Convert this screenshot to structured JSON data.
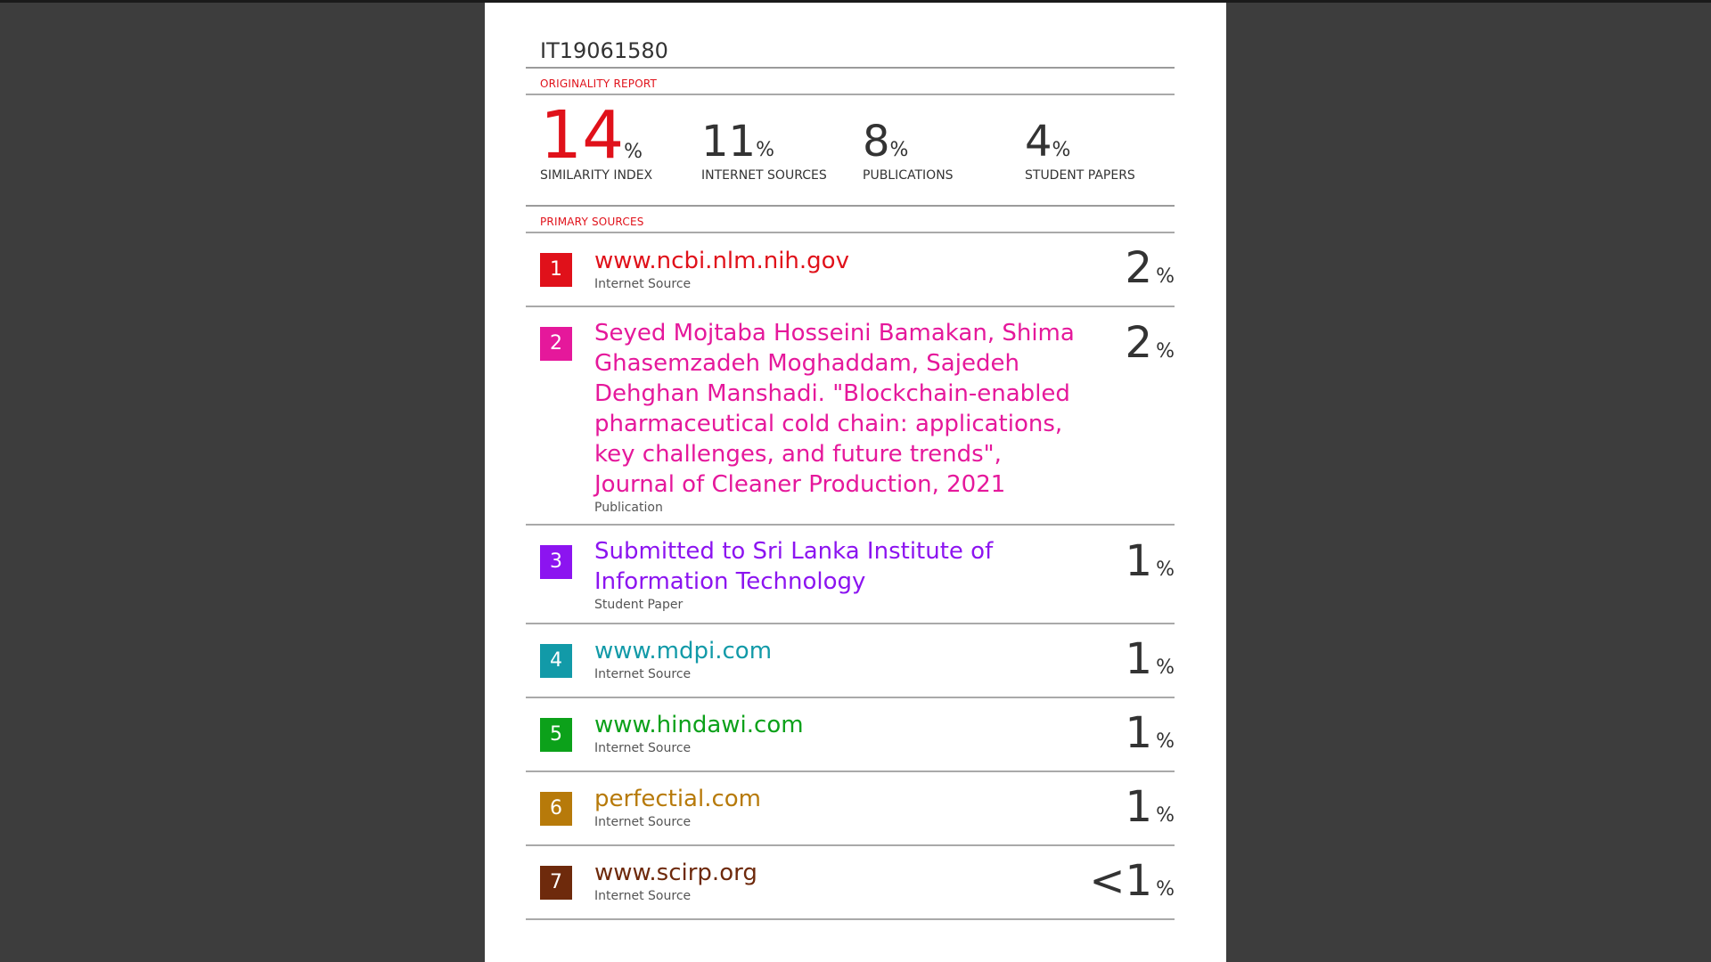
{
  "document_id": "IT19061580",
  "originality_report_label": "ORIGINALITY REPORT",
  "stats": [
    {
      "value": "14",
      "unit": "%",
      "label": "SIMILARITY INDEX"
    },
    {
      "value": "11",
      "unit": "%",
      "label": "INTERNET SOURCES"
    },
    {
      "value": "8",
      "unit": "%",
      "label": "PUBLICATIONS"
    },
    {
      "value": "4",
      "unit": "%",
      "label": "STUDENT PAPERS"
    }
  ],
  "primary_sources_label": "PRIMARY SOURCES",
  "sources": [
    {
      "rank": "1",
      "title": "www.ncbi.nlm.nih.gov",
      "type": "Internet Source",
      "percent": "2",
      "unit": "%",
      "color": "#e0111a"
    },
    {
      "rank": "2",
      "title": "Seyed Mojtaba Hosseini Bamakan, Shima Ghasemzadeh Moghaddam, Sajedeh Dehghan Manshadi. \"Blockchain-enabled pharmaceutical cold chain: applications, key challenges, and future trends\", Journal of Cleaner Production, 2021",
      "type": "Publication",
      "percent": "2",
      "unit": "%",
      "color": "#e5189b"
    },
    {
      "rank": "3",
      "title": "Submitted to Sri Lanka Institute of Information Technology",
      "type": "Student Paper",
      "percent": "1",
      "unit": "%",
      "color": "#8c14f0"
    },
    {
      "rank": "4",
      "title": "www.mdpi.com",
      "type": "Internet Source",
      "percent": "1",
      "unit": "%",
      "color": "#129aa8"
    },
    {
      "rank": "5",
      "title": "www.hindawi.com",
      "type": "Internet Source",
      "percent": "1",
      "unit": "%",
      "color": "#0ca11a"
    },
    {
      "rank": "6",
      "title": "perfectial.com",
      "type": "Internet Source",
      "percent": "1",
      "unit": "%",
      "color": "#b77a0a"
    },
    {
      "rank": "7",
      "title": "www.scirp.org",
      "type": "Internet Source",
      "percent": "<1",
      "unit": "%",
      "color": "#6e2a0c"
    }
  ]
}
